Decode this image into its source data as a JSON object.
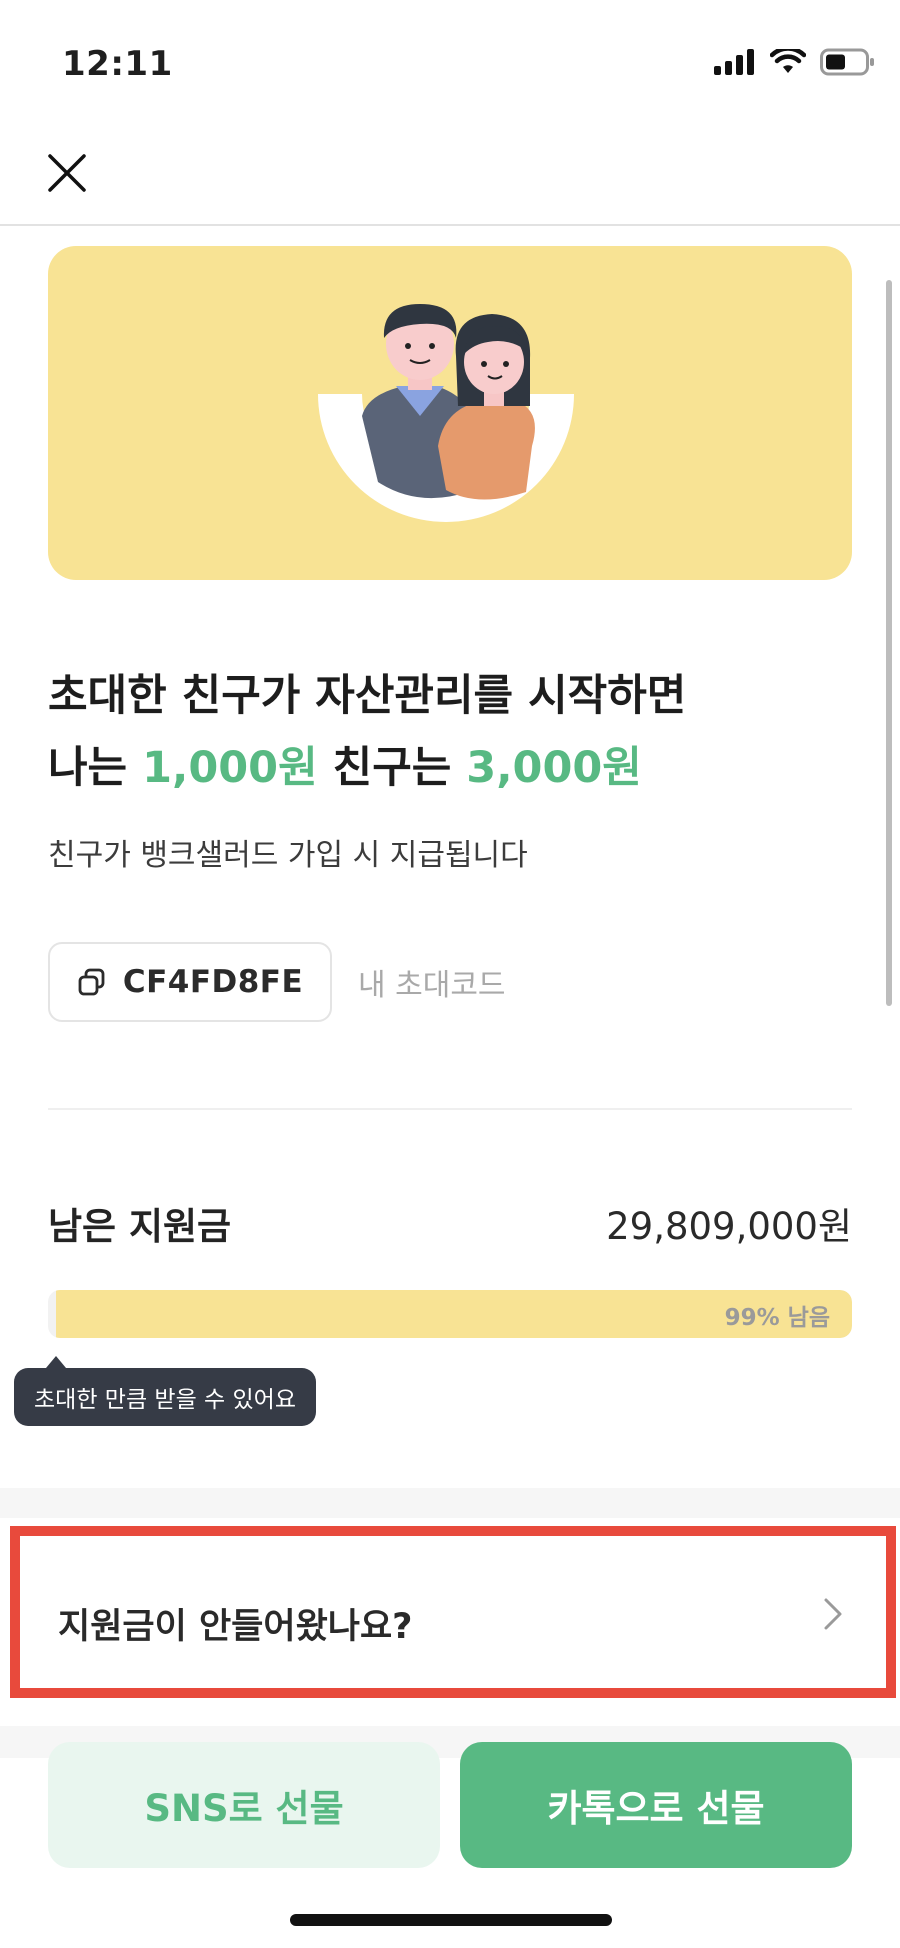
{
  "status_bar": {
    "time": "12:11"
  },
  "headline": {
    "line1": "초대한 친구가 자산관리를 시작하면",
    "line2_prefix": "나는 ",
    "my_reward": "1,000원",
    "line2_mid": " 친구는 ",
    "friend_reward": "3,000원"
  },
  "subtext": "친구가 뱅크샐러드 가입 시 지급됩니다",
  "invite": {
    "code": "CF4FD8FE",
    "label": "내 초대코드"
  },
  "remaining": {
    "title": "남은 지원금",
    "amount": "29,809,000원",
    "progress_label": "99% 남음",
    "progress_fraction": 0.99
  },
  "tooltip": "초대한 만큼 받을 수 있어요",
  "faq": {
    "label": "지원금이 안들어왔나요?"
  },
  "buttons": {
    "sns": "SNS로 선물",
    "kakao": "카톡으로 선물"
  },
  "icons": {
    "close": "close-icon",
    "copy": "copy-icon",
    "chevron": "chevron-right-icon",
    "signal": "signal-icon",
    "wifi": "wifi-icon",
    "battery": "battery-icon"
  },
  "colors": {
    "accent_green": "#58b983",
    "banner_yellow": "#f8e394",
    "highlight_red": "#e84a3c",
    "tooltip_bg": "#363b46"
  }
}
